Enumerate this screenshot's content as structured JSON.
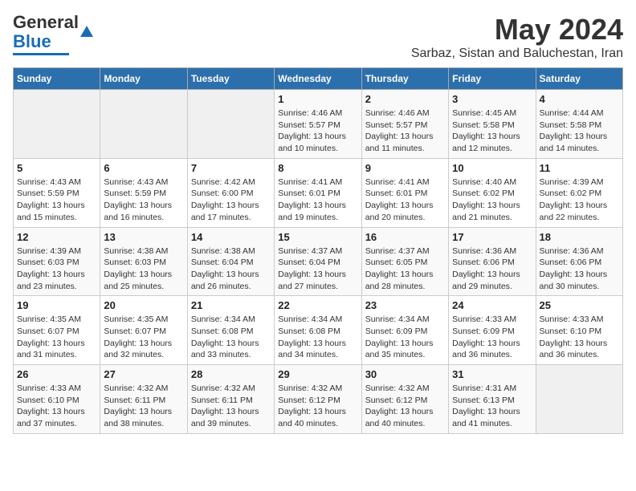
{
  "logo": {
    "part1": "General",
    "part2": "Blue"
  },
  "title": "May 2024",
  "subtitle": "Sarbaz, Sistan and Baluchestan, Iran",
  "headers": [
    "Sunday",
    "Monday",
    "Tuesday",
    "Wednesday",
    "Thursday",
    "Friday",
    "Saturday"
  ],
  "weeks": [
    [
      {
        "num": "",
        "info": ""
      },
      {
        "num": "",
        "info": ""
      },
      {
        "num": "",
        "info": ""
      },
      {
        "num": "1",
        "info": "Sunrise: 4:46 AM\nSunset: 5:57 PM\nDaylight: 13 hours\nand 10 minutes."
      },
      {
        "num": "2",
        "info": "Sunrise: 4:46 AM\nSunset: 5:57 PM\nDaylight: 13 hours\nand 11 minutes."
      },
      {
        "num": "3",
        "info": "Sunrise: 4:45 AM\nSunset: 5:58 PM\nDaylight: 13 hours\nand 12 minutes."
      },
      {
        "num": "4",
        "info": "Sunrise: 4:44 AM\nSunset: 5:58 PM\nDaylight: 13 hours\nand 14 minutes."
      }
    ],
    [
      {
        "num": "5",
        "info": "Sunrise: 4:43 AM\nSunset: 5:59 PM\nDaylight: 13 hours\nand 15 minutes."
      },
      {
        "num": "6",
        "info": "Sunrise: 4:43 AM\nSunset: 5:59 PM\nDaylight: 13 hours\nand 16 minutes."
      },
      {
        "num": "7",
        "info": "Sunrise: 4:42 AM\nSunset: 6:00 PM\nDaylight: 13 hours\nand 17 minutes."
      },
      {
        "num": "8",
        "info": "Sunrise: 4:41 AM\nSunset: 6:01 PM\nDaylight: 13 hours\nand 19 minutes."
      },
      {
        "num": "9",
        "info": "Sunrise: 4:41 AM\nSunset: 6:01 PM\nDaylight: 13 hours\nand 20 minutes."
      },
      {
        "num": "10",
        "info": "Sunrise: 4:40 AM\nSunset: 6:02 PM\nDaylight: 13 hours\nand 21 minutes."
      },
      {
        "num": "11",
        "info": "Sunrise: 4:39 AM\nSunset: 6:02 PM\nDaylight: 13 hours\nand 22 minutes."
      }
    ],
    [
      {
        "num": "12",
        "info": "Sunrise: 4:39 AM\nSunset: 6:03 PM\nDaylight: 13 hours\nand 23 minutes."
      },
      {
        "num": "13",
        "info": "Sunrise: 4:38 AM\nSunset: 6:03 PM\nDaylight: 13 hours\nand 25 minutes."
      },
      {
        "num": "14",
        "info": "Sunrise: 4:38 AM\nSunset: 6:04 PM\nDaylight: 13 hours\nand 26 minutes."
      },
      {
        "num": "15",
        "info": "Sunrise: 4:37 AM\nSunset: 6:04 PM\nDaylight: 13 hours\nand 27 minutes."
      },
      {
        "num": "16",
        "info": "Sunrise: 4:37 AM\nSunset: 6:05 PM\nDaylight: 13 hours\nand 28 minutes."
      },
      {
        "num": "17",
        "info": "Sunrise: 4:36 AM\nSunset: 6:06 PM\nDaylight: 13 hours\nand 29 minutes."
      },
      {
        "num": "18",
        "info": "Sunrise: 4:36 AM\nSunset: 6:06 PM\nDaylight: 13 hours\nand 30 minutes."
      }
    ],
    [
      {
        "num": "19",
        "info": "Sunrise: 4:35 AM\nSunset: 6:07 PM\nDaylight: 13 hours\nand 31 minutes."
      },
      {
        "num": "20",
        "info": "Sunrise: 4:35 AM\nSunset: 6:07 PM\nDaylight: 13 hours\nand 32 minutes."
      },
      {
        "num": "21",
        "info": "Sunrise: 4:34 AM\nSunset: 6:08 PM\nDaylight: 13 hours\nand 33 minutes."
      },
      {
        "num": "22",
        "info": "Sunrise: 4:34 AM\nSunset: 6:08 PM\nDaylight: 13 hours\nand 34 minutes."
      },
      {
        "num": "23",
        "info": "Sunrise: 4:34 AM\nSunset: 6:09 PM\nDaylight: 13 hours\nand 35 minutes."
      },
      {
        "num": "24",
        "info": "Sunrise: 4:33 AM\nSunset: 6:09 PM\nDaylight: 13 hours\nand 36 minutes."
      },
      {
        "num": "25",
        "info": "Sunrise: 4:33 AM\nSunset: 6:10 PM\nDaylight: 13 hours\nand 36 minutes."
      }
    ],
    [
      {
        "num": "26",
        "info": "Sunrise: 4:33 AM\nSunset: 6:10 PM\nDaylight: 13 hours\nand 37 minutes."
      },
      {
        "num": "27",
        "info": "Sunrise: 4:32 AM\nSunset: 6:11 PM\nDaylight: 13 hours\nand 38 minutes."
      },
      {
        "num": "28",
        "info": "Sunrise: 4:32 AM\nSunset: 6:11 PM\nDaylight: 13 hours\nand 39 minutes."
      },
      {
        "num": "29",
        "info": "Sunrise: 4:32 AM\nSunset: 6:12 PM\nDaylight: 13 hours\nand 40 minutes."
      },
      {
        "num": "30",
        "info": "Sunrise: 4:32 AM\nSunset: 6:12 PM\nDaylight: 13 hours\nand 40 minutes."
      },
      {
        "num": "31",
        "info": "Sunrise: 4:31 AM\nSunset: 6:13 PM\nDaylight: 13 hours\nand 41 minutes."
      },
      {
        "num": "",
        "info": ""
      }
    ]
  ]
}
